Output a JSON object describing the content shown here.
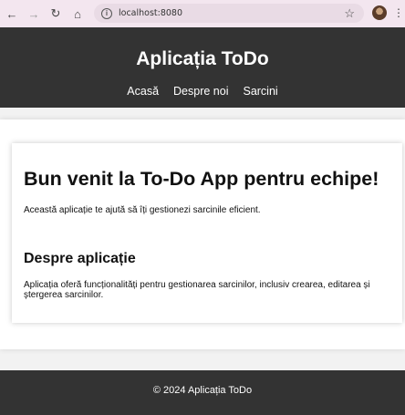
{
  "browser": {
    "url": "localhost:8080",
    "icons": {
      "back": "arrow-left-icon",
      "forward": "arrow-right-icon",
      "reload": "reload-icon",
      "home": "home-icon",
      "site_info": "info-icon",
      "bookmark": "star-icon",
      "profile": "avatar",
      "menu": "kebab-menu-icon"
    }
  },
  "header": {
    "title": "Aplicația ToDo",
    "nav": [
      {
        "label": "Acasă"
      },
      {
        "label": "Despre noi"
      },
      {
        "label": "Sarcini"
      }
    ]
  },
  "main": {
    "welcome_heading": "Bun venit la To-Do App pentru echipe!",
    "intro": "Această aplicație te ajută să îți gestionezi sarcinile eficient.",
    "about_heading": "Despre aplicație",
    "about_text": "Aplicația oferă funcționalități pentru gestionarea sarcinilor, inclusiv crearea, editarea și ștergerea sarcinilor."
  },
  "footer": {
    "text": "© 2024 Aplicația ToDo"
  },
  "colors": {
    "header_bg": "#333333",
    "footer_bg": "#333333",
    "page_bg": "#f2f2f2",
    "card_bg": "#ffffff",
    "browser_bar": "#f3e6ef"
  }
}
